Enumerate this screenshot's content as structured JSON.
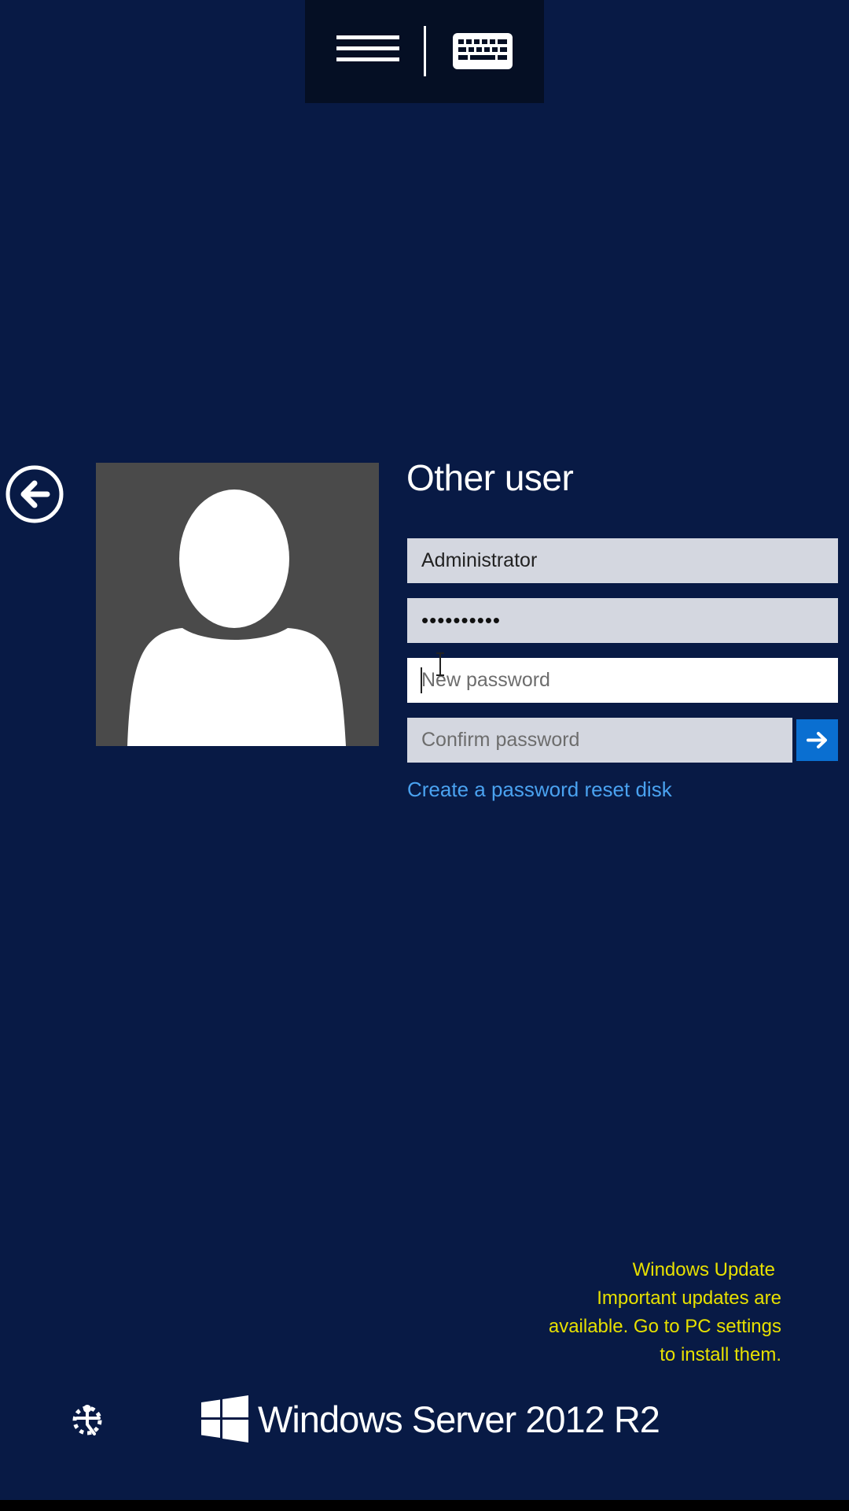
{
  "toolbar": {
    "icons": [
      "hamburger-menu-icon",
      "keyboard-icon"
    ]
  },
  "login": {
    "title": "Other user",
    "username_value": "Administrator",
    "password_value": "••••••••••",
    "new_password_placeholder": "New password",
    "confirm_password_placeholder": "Confirm password",
    "reset_link": "Create a password reset disk",
    "back_icon": "back-arrow-icon",
    "submit_icon": "right-arrow-icon"
  },
  "notification": {
    "title": "Windows Update",
    "line1": "Important updates are",
    "line2": "available. Go to PC settings",
    "line3": "to install them."
  },
  "footer": {
    "brand": "Windows Server 2012 R2",
    "ease_icon": "ease-of-access-icon"
  },
  "colors": {
    "background": "#081a45",
    "accent": "#0a6fd1",
    "link": "#4aa2f0",
    "notification": "#e7e000"
  }
}
